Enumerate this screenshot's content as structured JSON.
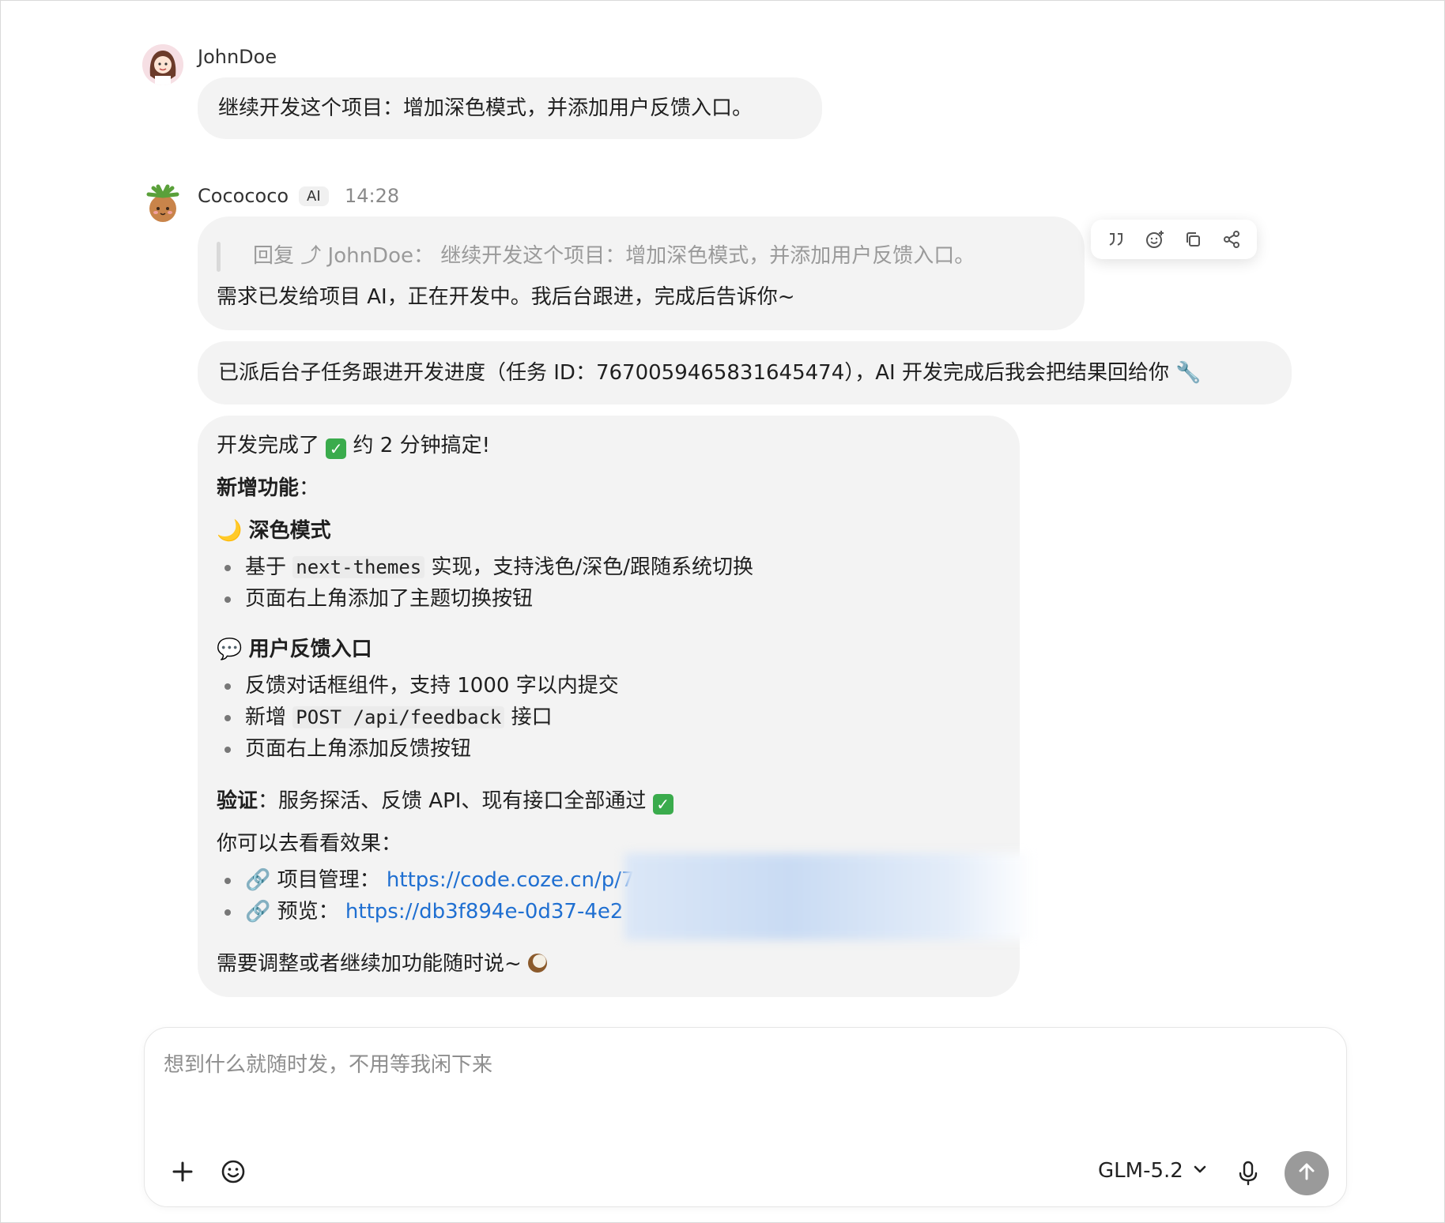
{
  "user_message": {
    "author": "JohnDoe",
    "text": "继续开发这个项目：增加深色模式，并添加用户反馈入口。"
  },
  "ai_message": {
    "author": "Cocococo",
    "badge": "AI",
    "time": "14:28",
    "reply_quote": "回复 ⤴ JohnDoe：  继续开发这个项目：增加深色模式，并添加用户反馈入口。",
    "reply_text": "需求已发给项目 AI，正在开发中。我后台跟进，完成后告诉你~",
    "followup_text": "已派后台子任务跟进开发进度（任务 ID：7670059465831645474），AI 开发完成后我会把结果回给你 🔧",
    "toolbar": {
      "quote_icon": "quote-icon",
      "emoji_icon": "add-reaction-icon",
      "copy_icon": "copy-icon",
      "share_icon": "share-icon"
    },
    "result": {
      "intro_a": "开发完成了",
      "intro_b": "约 2 分钟搞定!",
      "new_features_label": "新增功能",
      "new_features_colon": "：",
      "section1_emoji": "🌙",
      "section1_title": "深色模式",
      "s1_item1_a": "基于",
      "s1_item1_code": "next-themes",
      "s1_item1_b": "实现，支持浅色/深色/跟随系统切换",
      "s1_item2": "页面右上角添加了主题切换按钮",
      "section2_emoji": "💬",
      "section2_title": "用户反馈入口",
      "s2_item1": "反馈对话框组件，支持 1000 字以内提交",
      "s2_item2_a": "新增",
      "s2_item2_code": "POST /api/feedback",
      "s2_item2_b": "接口",
      "s2_item3": "页面右上角添加反馈按钮",
      "verify_label": "验证",
      "verify_text": "：服务探活、反馈 API、现有接口全部通过",
      "check_mark": "✓",
      "look_text": "你可以去看看效果：",
      "link_emoji": "🔗",
      "link1_label": "项目管理：",
      "link1_url": "https://code.coze.cn/p/7",
      "link2_label": "预览：",
      "link2_url": "https://db3f894e-0d37-4e2",
      "closing": "需要调整或者继续加功能随时说~"
    }
  },
  "composer": {
    "placeholder": "想到什么就随时发，不用等我闲下来",
    "model": "GLM-5.2",
    "icons": [
      "plus-icon",
      "emoji-icon",
      "chevron-down-icon",
      "microphone-icon",
      "send-arrow-icon"
    ]
  },
  "colors": {
    "bubble": "#f3f3f3",
    "link": "#1f6fd1",
    "send_button": "#9a9a9a",
    "check": "#3aab4c"
  }
}
